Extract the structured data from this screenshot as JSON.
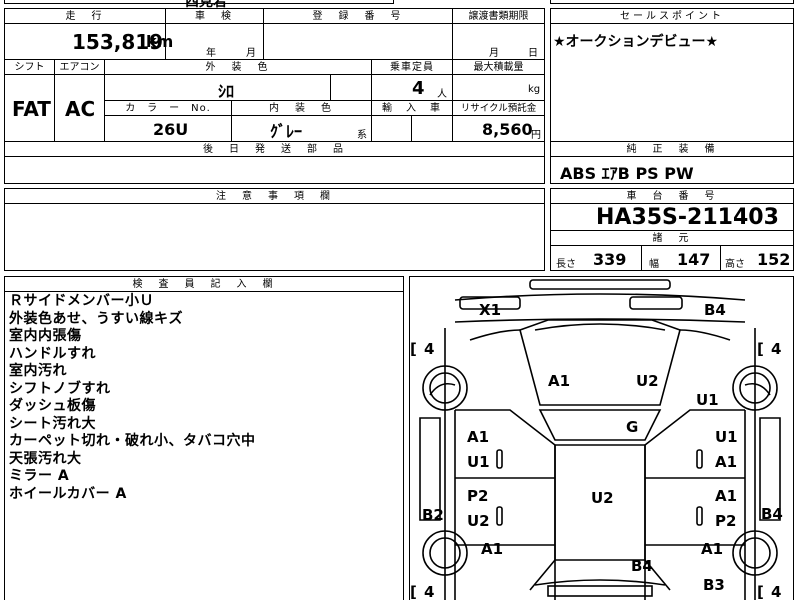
{
  "header_fragment": "西見宕",
  "mileage": {
    "label": "走　行",
    "value": "153,819",
    "unit": "km"
  },
  "inspection": {
    "label": "車　検",
    "year_unit": "年",
    "month_unit": "月"
  },
  "registration": {
    "label": "登　録　番　号"
  },
  "transfer_docs": {
    "label": "譲渡書類期限",
    "month_unit": "月",
    "day_unit": "日"
  },
  "sales_point": {
    "label": "セールスポイント",
    "text": "★オークションデビュー★"
  },
  "shift": {
    "label": "シフト",
    "value": "FAT"
  },
  "aircon": {
    "label": "エアコン",
    "value": "AC"
  },
  "exterior_color": {
    "label": "外　装　色",
    "value": "ｼﾛ"
  },
  "capacity": {
    "label": "乗車定員",
    "value": "4",
    "unit": "人"
  },
  "max_load": {
    "label": "最大積載量",
    "unit": "kg"
  },
  "color_no": {
    "label": "カ　ラ　ー　No.",
    "value": "26U"
  },
  "interior_color": {
    "label": "内　装　色",
    "value": "ｸﾞﾚｰ",
    "suffix": "系"
  },
  "import_car": {
    "label": "輸　入　車"
  },
  "recycle": {
    "label": "リサイクル預託金",
    "value": "8,560",
    "unit": "円"
  },
  "later_parts": {
    "label": "後　日　発　送　部　品"
  },
  "standard_equipment": {
    "label": "純　正　装　備",
    "value": "ABS ｴｱB PS PW"
  },
  "caution": {
    "label": "注　意　事　項　欄"
  },
  "chassis": {
    "label": "車　台　番　号",
    "value": "HA35S-211403"
  },
  "specs": {
    "label": "諸　元",
    "length_label": "長さ",
    "length": "339",
    "width_label": "幅",
    "width": "147",
    "height_label": "高さ",
    "height": "152"
  },
  "inspector": {
    "label": "検　査　員　記　入　欄",
    "lines": [
      "Ｒサイドメンバー小Ｕ",
      "外装色あせ、うすい線キズ",
      "室内内張傷",
      "ハンドルすれ",
      "室内汚れ",
      "シフトノブすれ",
      "ダッシュ板傷",
      "シート汚れ大",
      "カーペット切れ・破れ小、タバコ穴中",
      "天張汚れ大",
      "ミラー A",
      "ホイールカバー A"
    ]
  },
  "diagram": {
    "tires": {
      "fl": "4",
      "fr": "4",
      "rl": "4",
      "rr": "4"
    },
    "marks": {
      "x1": "X1",
      "b4_top": "B4",
      "a1_hood": "A1",
      "u2_hood": "U2",
      "u1_fender": "U1",
      "g_windshield": "G",
      "a1_ldoor_top": "A1",
      "u1_ldoor": "U1",
      "u1_rdoor_top": "U1",
      "a1_rdoor": "A1",
      "p2_lrear": "P2",
      "u2_lrear": "U2",
      "a1_rrear": "A1",
      "p2_rrear": "P2",
      "u2_roof": "U2",
      "b2_left": "B2",
      "b4_right": "B4",
      "a1_lquarter": "A1",
      "a1_rquarter": "A1",
      "b4_trunk": "B4",
      "b3_bumper": "B3"
    }
  }
}
